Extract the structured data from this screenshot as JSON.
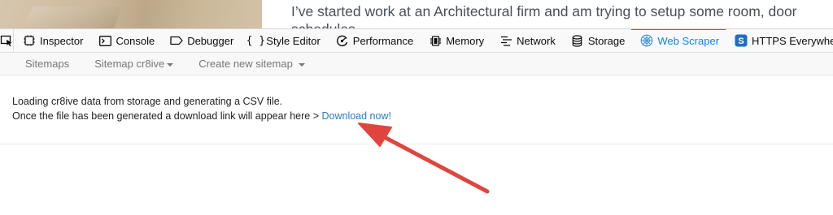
{
  "page": {
    "paragraph_line1": "I’ve started work at an Architectural firm and am trying to setup some room, door",
    "paragraph_line2": "schedules"
  },
  "devtools": {
    "picker_icon": "element-picker-icon",
    "tabs": [
      {
        "label": "Inspector",
        "icon": "inspector-icon",
        "active": false
      },
      {
        "label": "Console",
        "icon": "console-icon",
        "active": false
      },
      {
        "label": "Debugger",
        "icon": "debugger-icon",
        "active": false
      },
      {
        "label": "Style Editor",
        "icon": "style-editor-icon",
        "active": false
      },
      {
        "label": "Performance",
        "icon": "performance-icon",
        "active": false
      },
      {
        "label": "Memory",
        "icon": "memory-icon",
        "active": false
      },
      {
        "label": "Network",
        "icon": "network-icon",
        "active": false
      },
      {
        "label": "Storage",
        "icon": "storage-icon",
        "active": false
      },
      {
        "label": "Web Scraper",
        "icon": "web-scraper-icon",
        "active": true
      },
      {
        "label": "HTTPS Everywhere",
        "icon": "https-everywhere-icon",
        "active": false
      }
    ],
    "active_color": "#0a84ff"
  },
  "scraper_nav": {
    "sitemaps": "Sitemaps",
    "current_sitemap": "Sitemap cr8ive",
    "create_new": "Create new sitemap"
  },
  "message": {
    "line1": "Loading cr8ive data from storage and generating a CSV file.",
    "line2": "Once the file has been generated a download link will appear here >",
    "download_link": "Download now!"
  },
  "annotation": {
    "type": "red-arrow",
    "color": "#e0453d"
  }
}
